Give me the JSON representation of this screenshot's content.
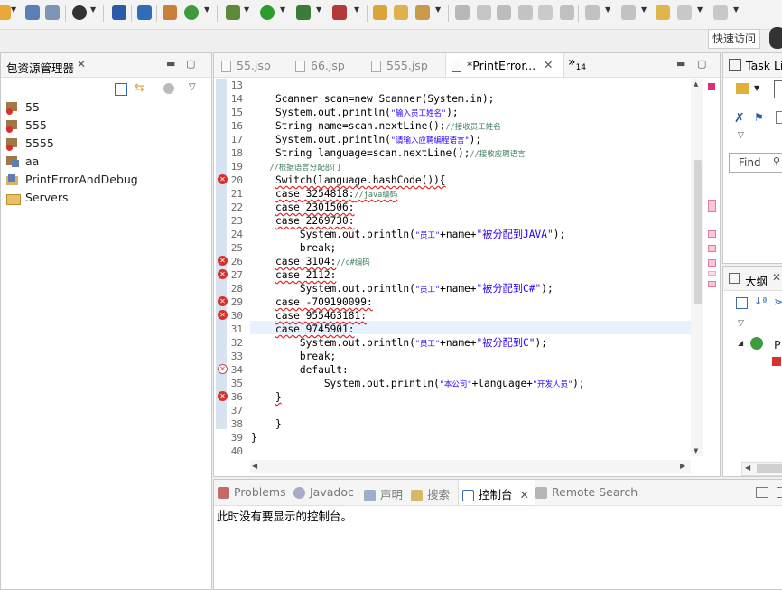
{
  "toolbar": {
    "quick_access_label": "快速访问"
  },
  "package_explorer": {
    "title": "包资源管理器",
    "items": [
      {
        "label": "55",
        "icon": "java-project-error-icon"
      },
      {
        "label": "555",
        "icon": "java-project-error-icon"
      },
      {
        "label": "5555",
        "icon": "java-project-error-icon"
      },
      {
        "label": "aa",
        "icon": "java-project-icon"
      },
      {
        "label": "PrintErrorAndDebug",
        "icon": "java-project-icon"
      },
      {
        "label": "Servers",
        "icon": "folder-icon"
      }
    ]
  },
  "editor": {
    "tabs": [
      {
        "label": "55.jsp",
        "active": false
      },
      {
        "label": "66.jsp",
        "active": false
      },
      {
        "label": "555.jsp",
        "active": false
      },
      {
        "label": "*PrintError...",
        "active": true
      }
    ],
    "overflow_count": "14",
    "overflow_symbol": "»",
    "line_numbers": [
      "13",
      "14",
      "15",
      "16",
      "17",
      "18",
      "19",
      "20",
      "21",
      "22",
      "23",
      "24",
      "25",
      "26",
      "27",
      "28",
      "29",
      "30",
      "31",
      "32",
      "33",
      "34",
      "35",
      "36",
      "37",
      "38",
      "39",
      "40"
    ],
    "code": {
      "l14": "    Scanner scan=new Scanner(System.in);",
      "l15a": "    System.out.println(",
      "l15s": "\"输入员工姓名\"",
      "l15b": ");",
      "l16a": "    String name=scan.nextLine();",
      "l16c": "//接收员工姓名",
      "l17a": "    System.out.println(",
      "l17s": "\"请输入应聘编程语言\"",
      "l17b": ");",
      "l18a": "    String language=scan.nextLine();",
      "l18c": "//接收应聘语言",
      "l19c": "    //根据语言分配部门",
      "l20": "Switch(language.hashCode()){",
      "l21a": "case 3254818:",
      "l21c": "//java编码",
      "l22": "case 2301506:",
      "l23": "case 2269730:",
      "l24a": "        System.out.println(",
      "l24s1": "\"员工\"",
      "l24m": "+name+",
      "l24s2": "\"被分配到JAVA\"",
      "l24b": ");",
      "l25": "        break;",
      "l26a": "case 3104:",
      "l26c": "//c#编码",
      "l27": "case 2112:",
      "l28a": "        System.out.println(",
      "l28s1": "\"员工\"",
      "l28m": "+name+",
      "l28s2": "\"被分配到C#\"",
      "l28b": ");",
      "l29": "case -709190099:",
      "l30": "case 955463181:",
      "l31": "case 9745901:",
      "l32a": "        System.out.println(",
      "l32s1": "\"员工\"",
      "l32m": "+name+",
      "l32s2": "\"被分配到C\"",
      "l32b": ");",
      "l33": "        break;",
      "l34": "        default:",
      "l35a": "            System.out.println(",
      "l35s1": "\"本公司\"",
      "l35m": "+language+",
      "l35s2": "\"开发人员\"",
      "l35b": ");",
      "l36": "}",
      "l38": "    }",
      "l39": "}"
    }
  },
  "task_list": {
    "title": "Task Li",
    "find_placeholder": "Find"
  },
  "outline": {
    "title": "大纲",
    "node_label": "P"
  },
  "console": {
    "tabs": [
      {
        "label": "Problems",
        "icon": "problems-icon",
        "active": false
      },
      {
        "label": "Javadoc",
        "icon": "javadoc-icon",
        "active": false
      },
      {
        "label": "声明",
        "icon": "declaration-icon",
        "active": false
      },
      {
        "label": "搜索",
        "icon": "search-icon",
        "active": false
      },
      {
        "label": "控制台",
        "icon": "console-icon",
        "active": true
      },
      {
        "label": "Remote Search",
        "icon": "remote-search-icon",
        "active": false
      }
    ],
    "message": "此时没有要显示的控制台。"
  },
  "colors": {
    "comment": "#3f7f5f",
    "string": "#2a00ff",
    "error": "#d9302c",
    "active_line": "#e8f2fe"
  }
}
